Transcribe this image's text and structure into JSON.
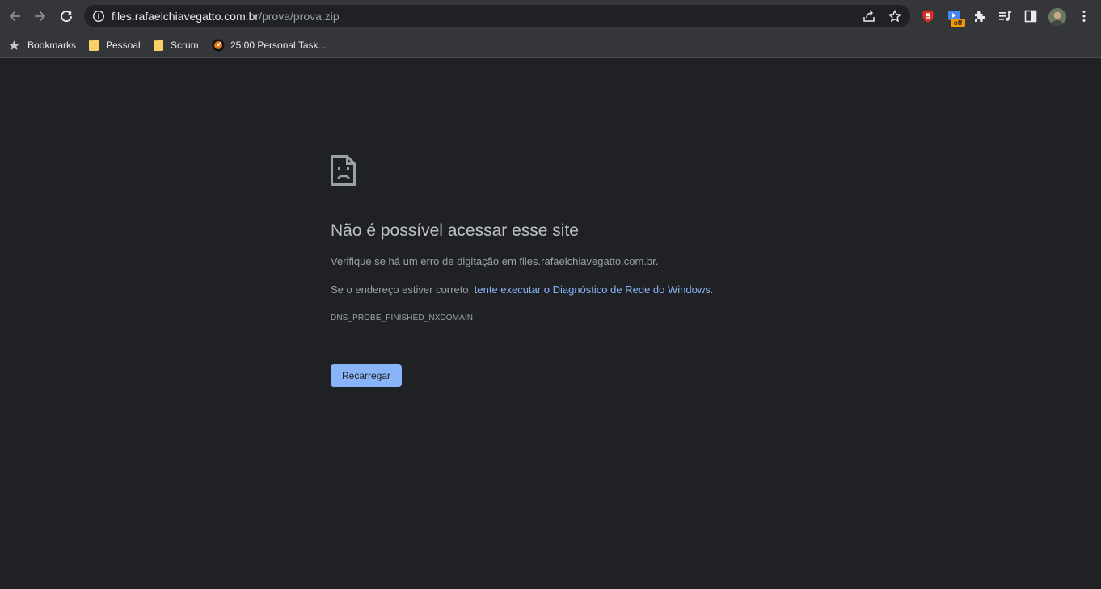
{
  "browser": {
    "url_host": "files.rafaelchiavegatto.com.br",
    "url_path": "/prova/prova.zip",
    "extension_badge": "off",
    "icons": {
      "back": "arrow-left-icon",
      "forward": "arrow-right-icon",
      "reload": "reload-icon",
      "site_info": "info-icon",
      "share": "share-icon",
      "bookmark": "star-icon",
      "extensions": "puzzle-icon",
      "reading_list": "reading-list-icon",
      "side_panel": "side-panel-icon",
      "menu": "kebab-menu-icon"
    }
  },
  "bookmarks": [
    {
      "label": "Bookmarks",
      "icon": "star-icon"
    },
    {
      "label": "Pessoal",
      "icon": "folder-icon"
    },
    {
      "label": "Scrum",
      "icon": "folder-icon"
    },
    {
      "label": "25:00 Personal Task...",
      "icon": "timer-icon"
    }
  ],
  "error": {
    "icon": "sad-document-icon",
    "title": "Não é possível acessar esse site",
    "line1": "Verifique se há um erro de digitação em files.rafaelchiavegatto.com.br.",
    "line2_prefix": "Se o endereço estiver correto, ",
    "line2_link": "tente executar o Diagnóstico de Rede do Windows",
    "line2_suffix": ".",
    "code": "DNS_PROBE_FINISHED_NXDOMAIN",
    "reload_label": "Recarregar"
  },
  "colors": {
    "page_background": "#202124",
    "toolbar": "#35363a",
    "link": "#8ab4f8",
    "button": "#8ab4f8",
    "badge": "#f29900"
  }
}
